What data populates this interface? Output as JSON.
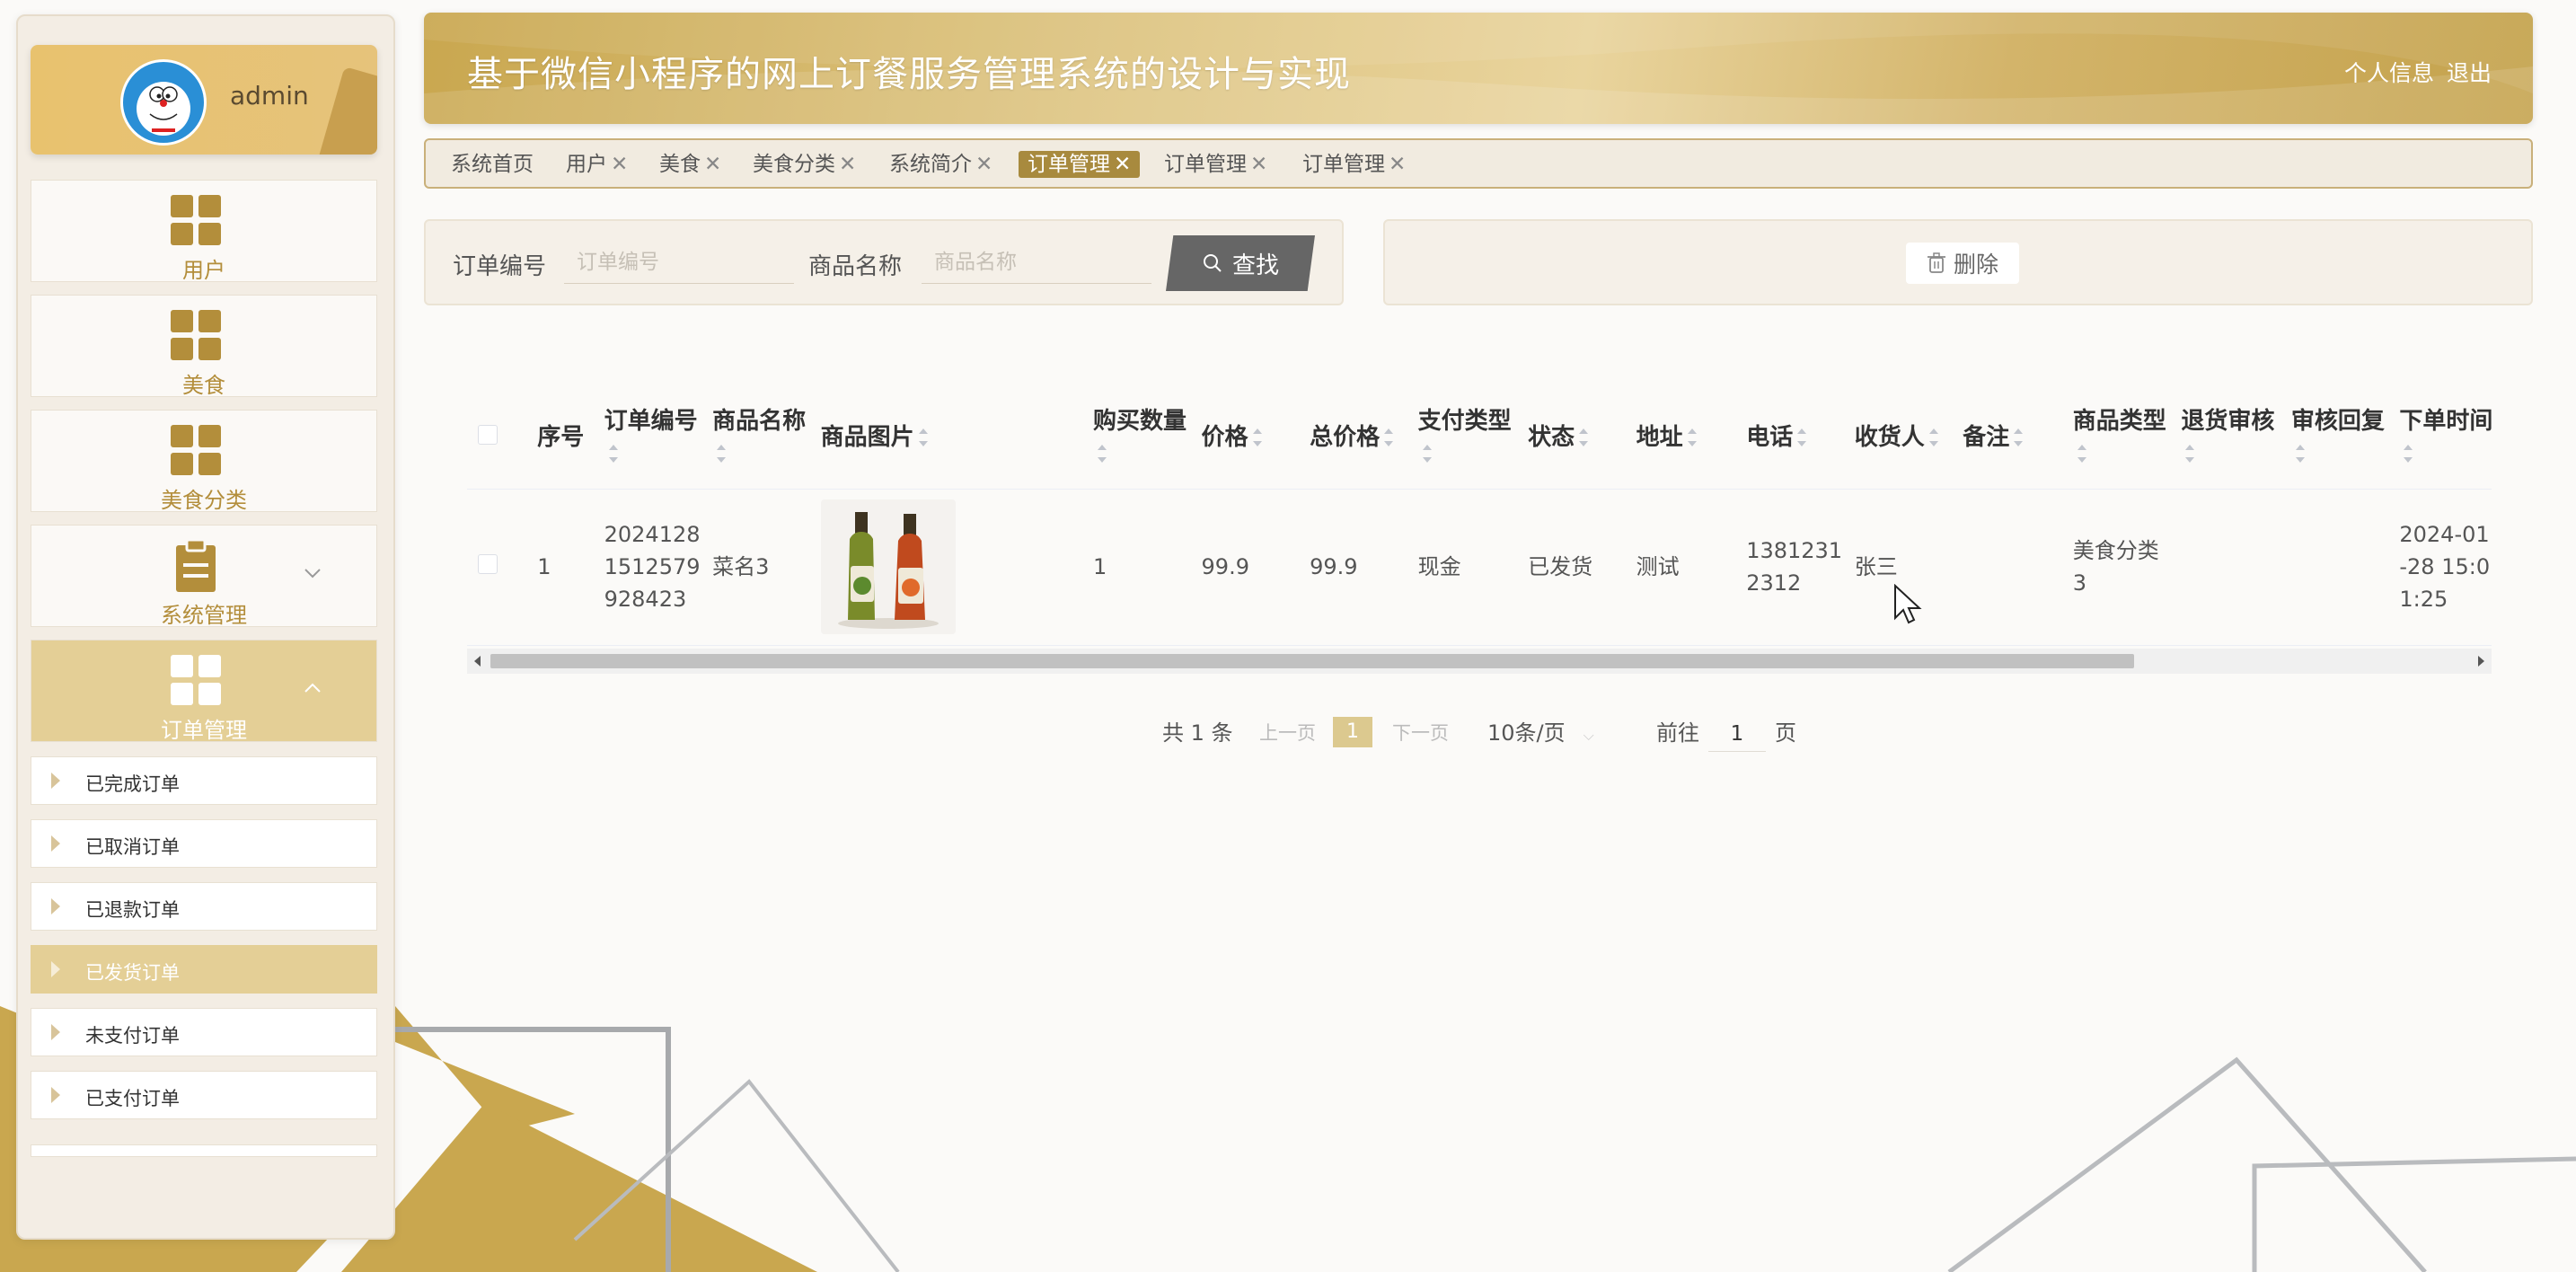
{
  "header": {
    "title": "基于微信小程序的网上订餐服务管理系统的设计与实现",
    "profile_link": "个人信息",
    "logout_link": "退出"
  },
  "sidebar": {
    "username": "admin",
    "menu": [
      {
        "label": "用户",
        "icon": "grid-icon"
      },
      {
        "label": "美食",
        "icon": "grid-icon"
      },
      {
        "label": "美食分类",
        "icon": "grid-icon"
      },
      {
        "label": "系统管理",
        "icon": "clipboard-icon"
      },
      {
        "label": "订单管理",
        "icon": "grid-icon"
      }
    ],
    "submenu": [
      {
        "label": "已完成订单"
      },
      {
        "label": "已取消订单"
      },
      {
        "label": "已退款订单"
      },
      {
        "label": "已发货订单"
      },
      {
        "label": "未支付订单"
      },
      {
        "label": "已支付订单"
      }
    ]
  },
  "tabs": [
    {
      "label": "系统首页"
    },
    {
      "label": "用户"
    },
    {
      "label": "美食"
    },
    {
      "label": "美食分类"
    },
    {
      "label": "系统简介"
    },
    {
      "label": "订单管理"
    },
    {
      "label": "订单管理"
    },
    {
      "label": "订单管理"
    }
  ],
  "search": {
    "order_no_label": "订单编号",
    "order_no_placeholder": "订单编号",
    "product_label": "商品名称",
    "product_placeholder": "商品名称",
    "search_button": "查找",
    "delete_button": "删除"
  },
  "table": {
    "headers": {
      "index": "序号",
      "order_no": "订单编号",
      "product_name": "商品名称",
      "product_image": "商品图片",
      "quantity": "购买数量",
      "price": "价格",
      "total": "总价格",
      "pay_type": "支付类型",
      "status": "状态",
      "address": "地址",
      "phone": "电话",
      "receiver": "收货人",
      "remark": "备注",
      "category": "商品类型",
      "refund_review": "退货审核",
      "review_reply": "审核回复",
      "order_time": "下单时间"
    },
    "rows": [
      {
        "index": "1",
        "order_no": "20241281512579928423",
        "product_name": "菜名3",
        "quantity": "1",
        "price": "99.9",
        "total": "99.9",
        "pay_type": "现金",
        "status": "已发货",
        "address": "测试",
        "phone": "13812312312",
        "receiver": "张三",
        "remark": "",
        "category": "美食分类3",
        "refund_review": "",
        "review_reply": "",
        "order_time": "2024-01-28 15:01:25"
      }
    ]
  },
  "pagination": {
    "total": "共 1 条",
    "prev": "上一页",
    "current": "1",
    "next": "下一页",
    "page_size": "10条/页",
    "goto_label": "前往",
    "goto_value": "1",
    "page_unit": "页"
  },
  "colors": {
    "accent": "#c9a74f",
    "active_tab": "#a88a3e",
    "menu_active": "#e4cf96"
  }
}
